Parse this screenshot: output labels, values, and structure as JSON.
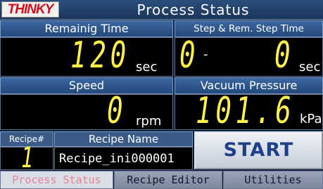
{
  "header": {
    "logo": "THINKY",
    "title": "Process Status"
  },
  "remaining_time": {
    "label": "Remainig Time",
    "value": "120",
    "unit": "sec"
  },
  "step_remaining": {
    "label": "Step & Rem. Step Time",
    "step_value": "0",
    "separator": "-",
    "time_value": "0",
    "unit": "sec"
  },
  "speed": {
    "label": "Speed",
    "value": "0",
    "unit": "rpm"
  },
  "vacuum": {
    "label": "Vacuum Pressure",
    "value": "101.6",
    "unit": "kPa"
  },
  "recipe": {
    "number_label": "Recipe#",
    "number_value": "1",
    "name_label": "Recipe Name",
    "name_value": "Recipe_ini000001"
  },
  "actions": {
    "start_label": "START"
  },
  "tabs": [
    {
      "label": "Process Status",
      "active": true
    },
    {
      "label": "Recipe Editor",
      "active": false
    },
    {
      "label": "Utilities",
      "active": false
    }
  ],
  "colors": {
    "segment": "#fff14a",
    "header_bg": "#2a4f7c",
    "start_text": "#1f3f88",
    "active_tab_text": "#e2879c"
  }
}
